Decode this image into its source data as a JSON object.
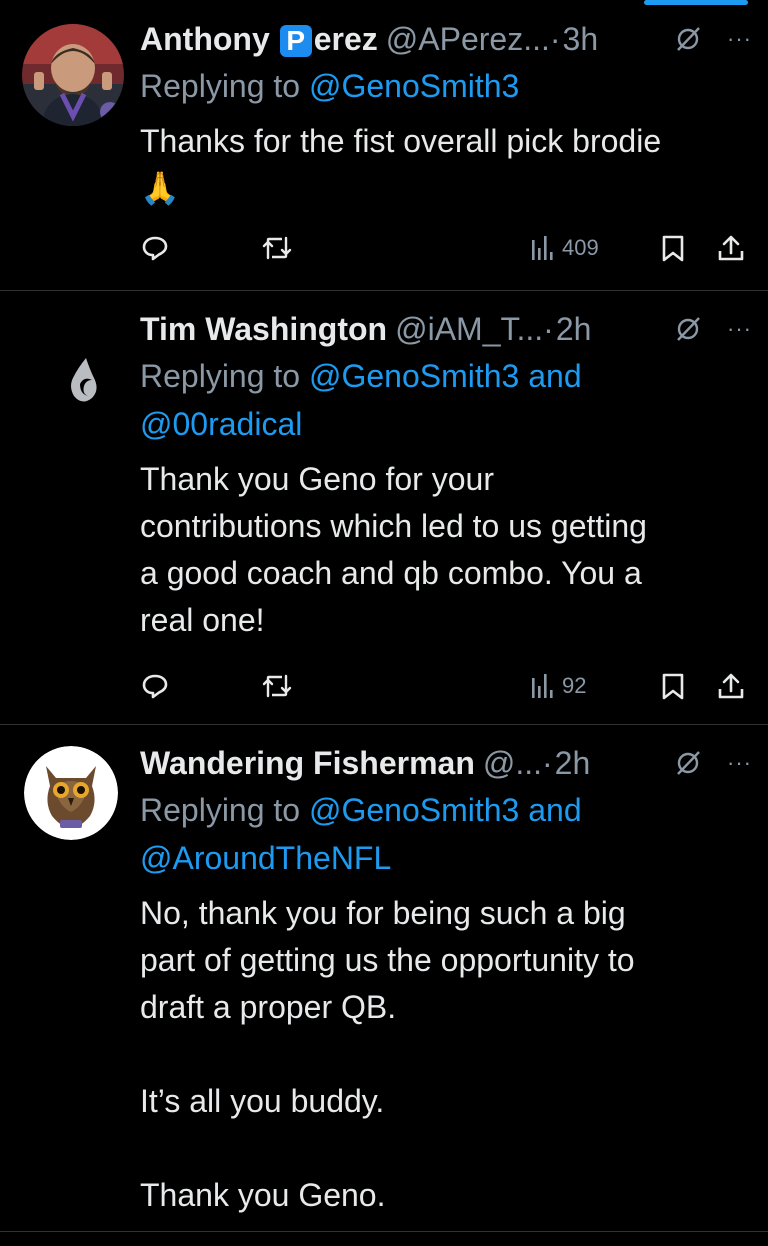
{
  "colors": {
    "background": "#000000",
    "text_primary": "#e7e9ea",
    "text_secondary": "#8b98a5",
    "accent": "#1d9bf0",
    "divider": "#2f3336"
  },
  "tweets": [
    {
      "name_before_badge": "Anthony",
      "name_badge": "P",
      "name_after_badge": "erez",
      "handle": "@APerez...",
      "separator": "·",
      "time": "3h",
      "reply_prefix": "Replying to ",
      "mentions": [
        "@GenoSmith3"
      ],
      "reply_join": "",
      "body": "Thanks for the fist overall pick brodie\n🙏",
      "views": "409",
      "icons": [
        "reply-icon",
        "retweet-icon",
        "views-icon",
        "bookmark-icon",
        "share-icon",
        "mute-icon",
        "more-icon"
      ]
    },
    {
      "name": "Tim Washington",
      "handle": "@iAM_T...",
      "separator": "·",
      "time": "2h",
      "reply_prefix": "Replying to ",
      "mentions": [
        "@GenoSmith3",
        "@00radical"
      ],
      "reply_join": " and",
      "body": "Thank you Geno for your\ncontributions which led to us getting\na good coach and qb combo.  You a\nreal one!",
      "views": "92"
    },
    {
      "name": "Wandering Fisherman",
      "handle": "@...",
      "separator": "·",
      "time": "2h",
      "reply_prefix": "Replying to ",
      "mentions": [
        "@GenoSmith3",
        "@AroundTheNFL"
      ],
      "reply_join": " and",
      "body": "No, thank you for being such a big\npart of getting us the opportunity to\ndraft a proper QB.\n\nIt’s all you buddy.\n\nThank you Geno."
    }
  ],
  "more_symbol": "···"
}
